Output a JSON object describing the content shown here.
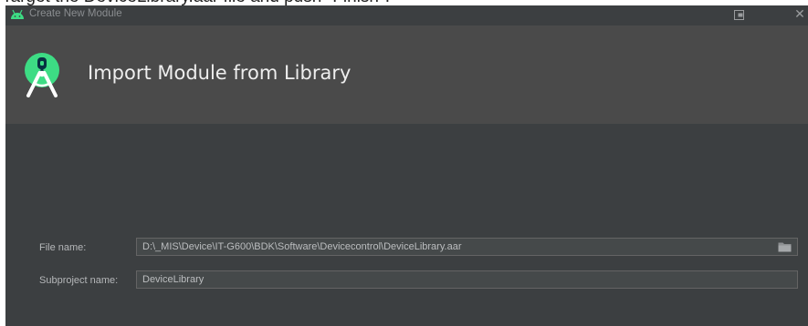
{
  "page_top_text": "Target the DeviceLibrary.aar file and push \"Finish\".",
  "window": {
    "title": "Create New Module",
    "close_glyph": "✕"
  },
  "banner": {
    "title": "Import Module from Library",
    "logo_icon": "android-studio-logo-icon"
  },
  "form": {
    "file_name_label": "File name:",
    "file_name_value": "D:\\_MIS\\Device\\IT-G600\\BDK\\Software\\Devicecontrol\\DeviceLibrary.aar",
    "browse_icon": "folder-icon",
    "subproject_label": "Subproject name:",
    "subproject_value": "DeviceLibrary"
  },
  "colors": {
    "window_bg": "#3c3f41",
    "banner_bg": "#4a4a4a",
    "logo_green": "#3ddc84",
    "field_bg": "#45494a"
  }
}
